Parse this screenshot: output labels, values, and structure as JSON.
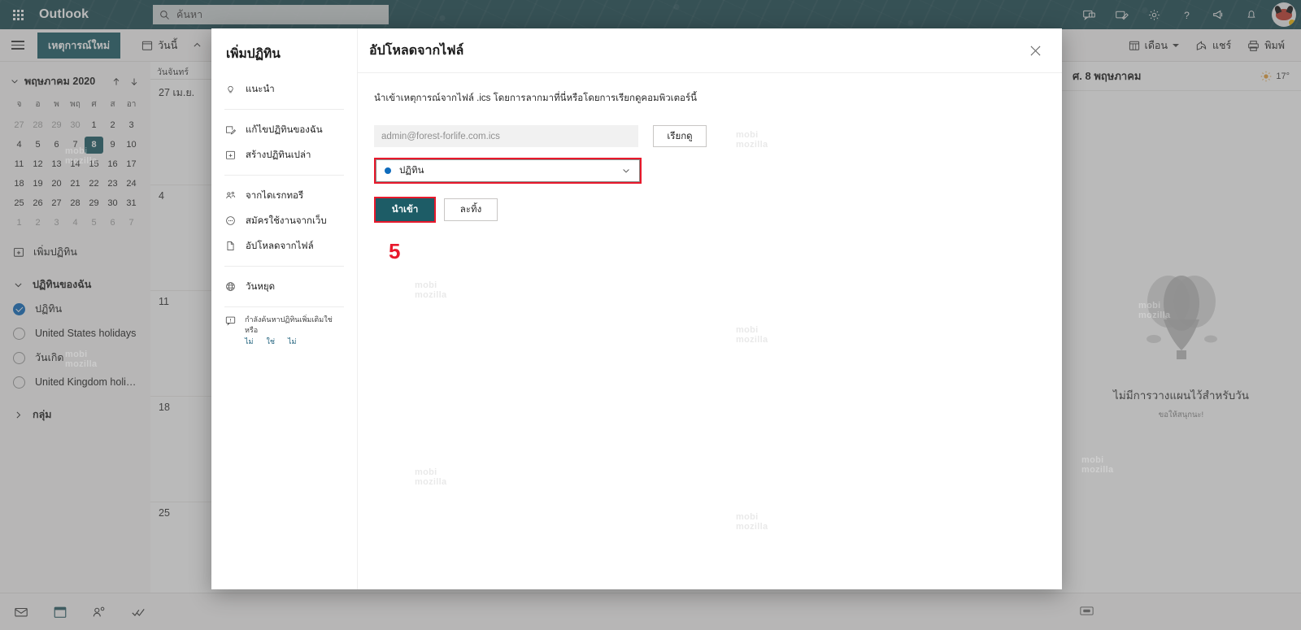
{
  "suite": {
    "brand": "Outlook",
    "search_placeholder": "ค้นหา",
    "waffle_icon": "app-launcher-icon",
    "icons": [
      "teams-chat-icon",
      "compose-icon",
      "settings-gear-icon",
      "help-question-icon",
      "feedback-megaphone-icon",
      "notification-bell-icon"
    ]
  },
  "command_bar": {
    "menu_icon": "hamburger-menu-icon",
    "new_event": "เหตุการณ์ใหม่",
    "today": "วันนี้",
    "prev_icon": "chevron-up-icon",
    "view_month": "เดือน",
    "share": "แชร์",
    "print": "พิมพ์"
  },
  "mini_calendar": {
    "title": "พฤษภาคม 2020",
    "collapse_icon": "chevron-down-icon",
    "up_icon": "arrow-up-icon",
    "down_icon": "arrow-down-icon",
    "dow": [
      "จ",
      "อ",
      "พ",
      "พฤ",
      "ศ",
      "ส",
      "อา"
    ],
    "weeks": [
      [
        {
          "d": "27",
          "muted": true
        },
        {
          "d": "28",
          "muted": true
        },
        {
          "d": "29",
          "muted": true
        },
        {
          "d": "30",
          "muted": true
        },
        {
          "d": "1"
        },
        {
          "d": "2"
        },
        {
          "d": "3"
        }
      ],
      [
        {
          "d": "4"
        },
        {
          "d": "5"
        },
        {
          "d": "6"
        },
        {
          "d": "7"
        },
        {
          "d": "8",
          "today": true
        },
        {
          "d": "9"
        },
        {
          "d": "10"
        }
      ],
      [
        {
          "d": "11"
        },
        {
          "d": "12"
        },
        {
          "d": "13"
        },
        {
          "d": "14"
        },
        {
          "d": "15"
        },
        {
          "d": "16"
        },
        {
          "d": "17"
        }
      ],
      [
        {
          "d": "18"
        },
        {
          "d": "19"
        },
        {
          "d": "20"
        },
        {
          "d": "21"
        },
        {
          "d": "22"
        },
        {
          "d": "23"
        },
        {
          "d": "24"
        }
      ],
      [
        {
          "d": "25"
        },
        {
          "d": "26"
        },
        {
          "d": "27"
        },
        {
          "d": "28"
        },
        {
          "d": "29"
        },
        {
          "d": "30"
        },
        {
          "d": "31"
        }
      ],
      [
        {
          "d": "1",
          "muted": true
        },
        {
          "d": "2",
          "muted": true
        },
        {
          "d": "3",
          "muted": true
        },
        {
          "d": "4",
          "muted": true
        },
        {
          "d": "5",
          "muted": true
        },
        {
          "d": "6",
          "muted": true
        },
        {
          "d": "7",
          "muted": true
        }
      ]
    ]
  },
  "rail": {
    "add_calendar": "เพิ่มปฏิทิน",
    "add_calendar_icon": "calendar-plus-icon",
    "my_calendars": "ปฏิทินของฉัน",
    "my_calendars_chevron": "chevron-down-icon",
    "calendars": [
      {
        "name": "ปฏิทิน",
        "checked": true
      },
      {
        "name": "United States holidays",
        "checked": false
      },
      {
        "name": "วันเกิด",
        "checked": false
      },
      {
        "name": "United Kingdom holid...",
        "checked": false
      }
    ],
    "groups": "กลุ่ม",
    "groups_chevron": "chevron-right-icon"
  },
  "calendar_grid": {
    "dow_header": "วันจันทร์",
    "day_numbers": [
      "27 เม.ย.",
      "4",
      "11",
      "18",
      "25"
    ]
  },
  "right_pane": {
    "date": "ศ. 8 พฤษภาคม",
    "weather_icon": "sun-icon",
    "temperature": "17°",
    "empty_title": "ไม่มีการวางแผนไว้สำหรับวัน",
    "empty_sub": "ขอให้สนุกนะ!",
    "empty_illustration": "hot-air-balloon-illustration"
  },
  "bottom_bar": {
    "icons": [
      "mail-icon",
      "calendar-icon",
      "people-icon",
      "tasks-icon"
    ],
    "status_icon": "keyboard-icon"
  },
  "modal": {
    "sidebar": {
      "title": "เพิ่มปฏิทิน",
      "items": [
        {
          "label": "แนะนำ",
          "icon": "lightbulb-icon"
        },
        {
          "label": "แก้ไขปฏิทินของฉัน",
          "icon": "edit-calendar-icon"
        },
        {
          "label": "สร้างปฏิทินเปล่า",
          "icon": "calendar-plus-icon"
        },
        {
          "label": "จากไดเรกทอรี",
          "icon": "directory-people-icon"
        },
        {
          "label": "สมัครใช้งานจากเว็บ",
          "icon": "globe-subscribe-icon"
        },
        {
          "label": "อัปโหลดจากไฟล์",
          "icon": "file-upload-icon"
        },
        {
          "label": "วันหยุด",
          "icon": "globe-icon"
        }
      ],
      "feedback": {
        "icon": "feedback-icon",
        "text": "กำลังค้นหาปฏิทินเพิ่มเติมใช่หรือ",
        "no1": "ไม่",
        "yes": "ใช่",
        "no2": "ไม่"
      }
    },
    "title": "อัปโหลดจากไฟล์",
    "close_icon": "close-icon",
    "description": "นำเข้าเหตุการณ์จากไฟล์ .ics โดยการลากมาที่นี่หรือโดยการเรียกดูคอมพิวเตอร์นี้",
    "file_value": "admin@forest-forlife.com.ics",
    "file_placeholder": "admin@forest-forlife.com.ics",
    "browse_label": "เรียกดู",
    "calendar_select_value": "ปฏิทิน",
    "select_chevron_icon": "chevron-down-icon",
    "import_label": "นำเข้า",
    "discard_label": "ละทิ้ง",
    "step_number": "5"
  },
  "colors": {
    "brand_teal": "#1d5c66",
    "suite_bar": "#1d4a52",
    "highlight_red": "#e8192c",
    "accent_blue": "#0f6cbd"
  },
  "watermarks": [
    "mobi mozilla",
    "mobi mozilla",
    "mobi mozilla",
    "mobi mozilla",
    "mobi mozilla",
    "mobi mozilla"
  ]
}
